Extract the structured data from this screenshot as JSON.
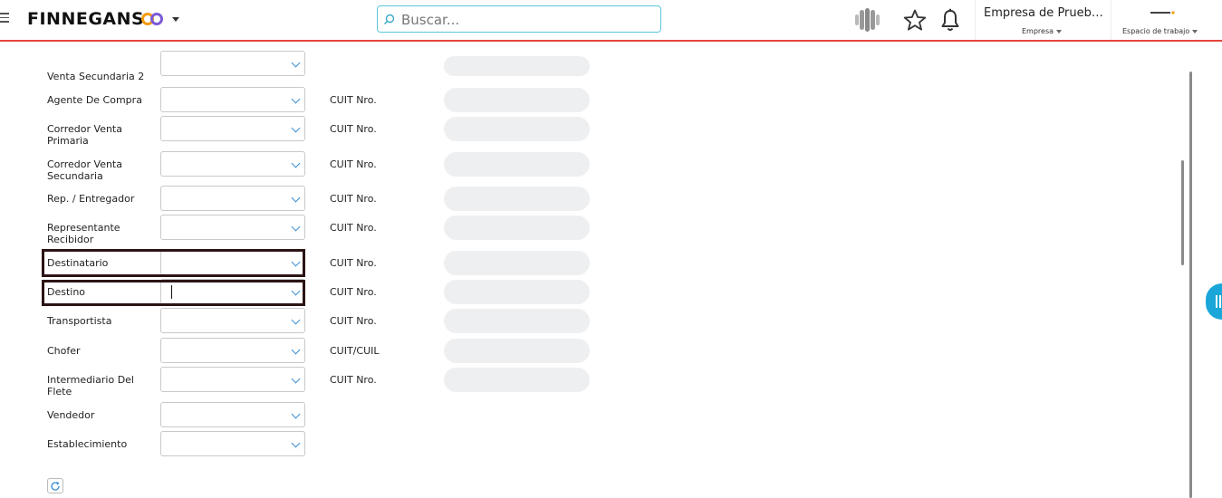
{
  "header": {
    "brand": "FINNEGANS",
    "search_placeholder": "Buscar...",
    "company_name": "Empresa de Prueba...",
    "company_label": "Empresa",
    "workspace_label": "Espacio de trabajo",
    "brand_colors": {
      "accent_red": "#e2453c",
      "search_border": "#5bc6dd",
      "logo_orange": "#f39c12",
      "logo_purple": "#7b5bd6"
    }
  },
  "form": {
    "rows": [
      {
        "label": "Venta Secundaria 2",
        "cuit": ""
      },
      {
        "label": "Agente De Compra",
        "cuit": "CUIT Nro."
      },
      {
        "label": "Corredor Venta Primaria",
        "cuit": "CUIT Nro."
      },
      {
        "label": "Corredor Venta Secundaria",
        "cuit": "CUIT Nro."
      },
      {
        "label": "Rep. / Entregador",
        "cuit": "CUIT Nro."
      },
      {
        "label": "Representante Recibidor",
        "cuit": "CUIT Nro."
      },
      {
        "label": "Destinatario",
        "cuit": "CUIT Nro."
      },
      {
        "label": "Destino",
        "cuit": "CUIT Nro."
      },
      {
        "label": "Transportista",
        "cuit": "CUIT Nro."
      },
      {
        "label": "Chofer",
        "cuit": "CUIT/CUIL"
      },
      {
        "label": "Intermediario Del Flete",
        "cuit": "CUIT Nro."
      },
      {
        "label": "Vendedor",
        "cuit": ""
      },
      {
        "label": "Establecimiento",
        "cuit": ""
      }
    ]
  },
  "icons": {
    "menu": "hamburger-icon",
    "search": "search-icon",
    "assistant": "assistant-icon",
    "favorite": "star-icon",
    "notifications": "bell-icon",
    "select": "chevron-down-icon",
    "refresh": "refresh-icon",
    "side_panel": "side-panel-icon"
  }
}
